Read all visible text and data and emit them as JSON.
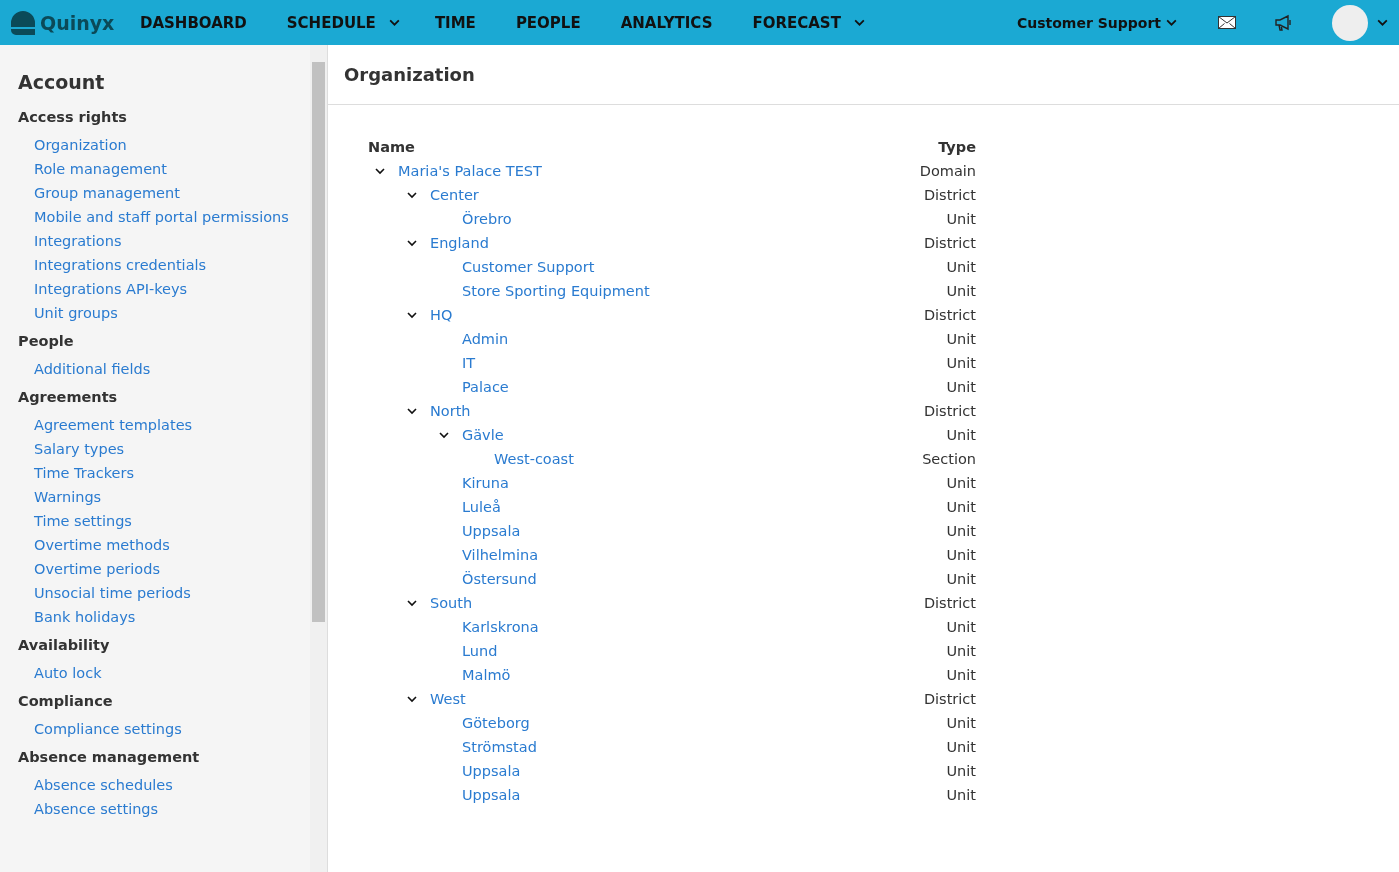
{
  "topbar": {
    "logo": "Quinyx",
    "nav": [
      {
        "label": "DASHBOARD",
        "dropdown": false
      },
      {
        "label": "SCHEDULE",
        "dropdown": true
      },
      {
        "label": "TIME",
        "dropdown": false
      },
      {
        "label": "PEOPLE",
        "dropdown": false
      },
      {
        "label": "ANALYTICS",
        "dropdown": false
      },
      {
        "label": "FORECAST",
        "dropdown": true
      }
    ],
    "unit_selector": "Customer Support"
  },
  "sidebar": {
    "title": "Account",
    "sections": [
      {
        "title": "Access rights",
        "items": [
          "Organization",
          "Role management",
          "Group management",
          "Mobile and staff portal permissions",
          "Integrations",
          "Integrations credentials",
          "Integrations API-keys",
          "Unit groups"
        ]
      },
      {
        "title": "People",
        "items": [
          "Additional fields"
        ]
      },
      {
        "title": "Agreements",
        "items": [
          "Agreement templates",
          "Salary types",
          "Time Trackers",
          "Warnings",
          "Time settings",
          "Overtime methods",
          "Overtime periods",
          "Unsocial time periods",
          "Bank holidays"
        ]
      },
      {
        "title": "Availability",
        "items": [
          "Auto lock"
        ]
      },
      {
        "title": "Compliance",
        "items": [
          "Compliance settings"
        ]
      },
      {
        "title": "Absence management",
        "items": [
          "Absence schedules",
          "Absence settings"
        ]
      }
    ]
  },
  "main": {
    "title": "Organization",
    "columns": [
      "Name",
      "Type"
    ],
    "tree": [
      {
        "name": "Maria's Palace TEST",
        "type": "Domain",
        "expanded": true,
        "children": [
          {
            "name": "Center",
            "type": "District",
            "expanded": true,
            "children": [
              {
                "name": "Örebro",
                "type": "Unit"
              }
            ]
          },
          {
            "name": "England",
            "type": "District",
            "expanded": true,
            "children": [
              {
                "name": "Customer Support",
                "type": "Unit"
              },
              {
                "name": "Store Sporting Equipment",
                "type": "Unit"
              }
            ]
          },
          {
            "name": "HQ",
            "type": "District",
            "expanded": true,
            "children": [
              {
                "name": "Admin",
                "type": "Unit"
              },
              {
                "name": "IT",
                "type": "Unit"
              },
              {
                "name": "Palace",
                "type": "Unit"
              }
            ]
          },
          {
            "name": "North",
            "type": "District",
            "expanded": true,
            "children": [
              {
                "name": "Gävle",
                "type": "Unit",
                "expanded": true,
                "children": [
                  {
                    "name": "West-coast",
                    "type": "Section"
                  }
                ]
              },
              {
                "name": "Kiruna",
                "type": "Unit"
              },
              {
                "name": "Luleå",
                "type": "Unit"
              },
              {
                "name": "Uppsala",
                "type": "Unit"
              },
              {
                "name": "Vilhelmina",
                "type": "Unit"
              },
              {
                "name": "Östersund",
                "type": "Unit"
              }
            ]
          },
          {
            "name": "South",
            "type": "District",
            "expanded": true,
            "children": [
              {
                "name": "Karlskrona",
                "type": "Unit"
              },
              {
                "name": "Lund",
                "type": "Unit"
              },
              {
                "name": "Malmö",
                "type": "Unit"
              }
            ]
          },
          {
            "name": "West",
            "type": "District",
            "expanded": true,
            "children": [
              {
                "name": "Göteborg",
                "type": "Unit"
              },
              {
                "name": "Strömstad",
                "type": "Unit"
              },
              {
                "name": "Uppsala",
                "type": "Unit"
              },
              {
                "name": "Uppsala",
                "type": "Unit"
              }
            ]
          }
        ]
      }
    ]
  }
}
